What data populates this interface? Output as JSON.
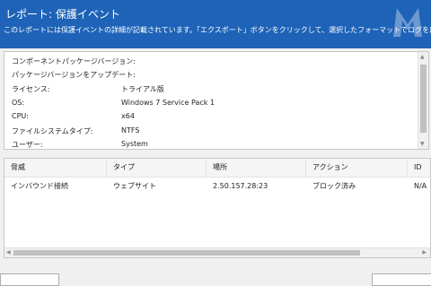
{
  "header": {
    "title": "レポート: 保護イベント",
    "subtitle": "このレポートには保護イベントの詳細が記載されています。「エクスポート」ボタンをクリックして、選択したフォーマットでログを出力します。",
    "logo_icon": "malwarebytes-logo-icon"
  },
  "details": {
    "rows": [
      {
        "label": "コンポーネントパッケージバージョン:",
        "value": ""
      },
      {
        "label": "パッケージバージョンをアップデート:",
        "value": ""
      },
      {
        "label": "ライセンス:",
        "value": "トライアル版"
      },
      {
        "label": "OS:",
        "value": "Windows 7 Service Pack 1"
      },
      {
        "label": "CPU:",
        "value": "x64"
      },
      {
        "label": "ファイルシステムタイプ:",
        "value": "NTFS"
      },
      {
        "label": "ユーザー:",
        "value": "System"
      }
    ]
  },
  "events": {
    "columns": [
      "脅威",
      "タイプ",
      "場所",
      "アクション",
      "ID"
    ],
    "rows": [
      [
        "インバウンド接続",
        "ウェブサイト",
        "2.50.157.28:23",
        "ブロック済み",
        "N/A"
      ]
    ]
  },
  "colors": {
    "header_bg": "#1e63b8",
    "panel_bg": "#ffffff",
    "window_bg": "#f0f0f0"
  }
}
